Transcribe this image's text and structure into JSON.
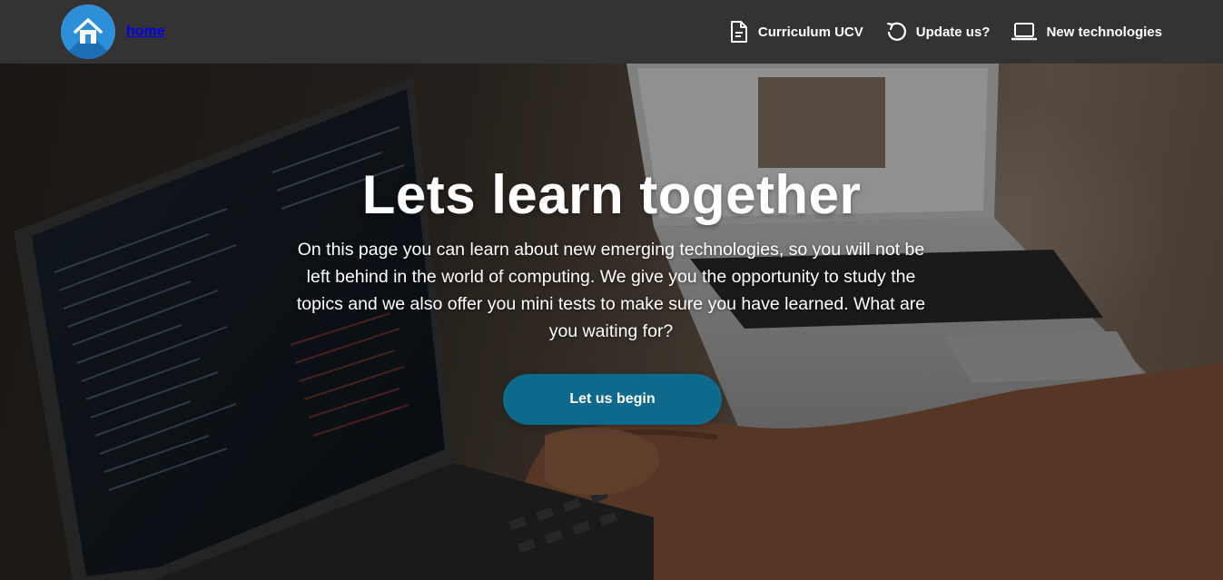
{
  "brand": {
    "icon": "home-icon",
    "label": "home"
  },
  "nav": {
    "items": [
      {
        "label": "Curriculum UCV",
        "icon": "document-icon"
      },
      {
        "label": "Update us?",
        "icon": "refresh-icon"
      },
      {
        "label": "New technologies",
        "icon": "laptop-icon"
      }
    ]
  },
  "hero": {
    "title": "Lets learn together",
    "text": "On this page you can learn about new emerging technologies, so you will not be left behind in the world of computing. We give you the opportunity to study the topics and we also offer you mini tests to make sure you have learned. What are you waiting for?",
    "button_label": "Let us begin"
  },
  "colors": {
    "navbar": "#333333",
    "brand_link": "#0000ee",
    "logo": "#2e8fd9",
    "button": "#0e6a8c",
    "text": "#ffffff"
  }
}
